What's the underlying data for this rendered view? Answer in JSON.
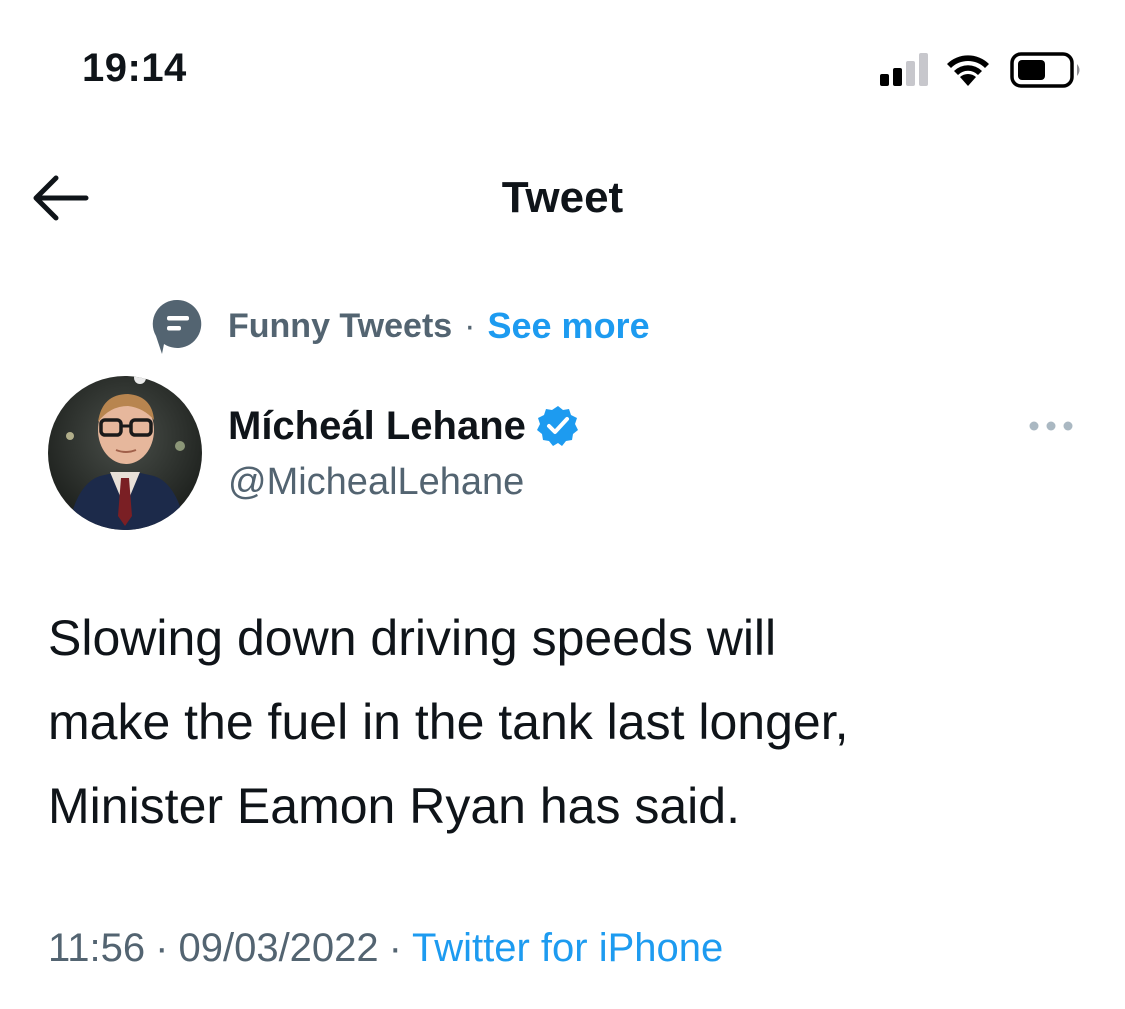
{
  "status_bar": {
    "time": "19:14"
  },
  "header": {
    "title": "Tweet"
  },
  "context": {
    "topic": "Funny Tweets",
    "separator": "·",
    "see_more": "See more"
  },
  "author": {
    "name": "Mícheál Lehane",
    "handle": "@MichealLehane",
    "verified": true
  },
  "tweet": {
    "text_lines": [
      "Slowing down driving speeds will",
      "make the fuel in the tank last longer,",
      "Minister Eamon Ryan has said."
    ]
  },
  "meta": {
    "time": "11:56",
    "date": "09/03/2022",
    "separator": "·",
    "source": "Twitter for iPhone"
  },
  "colors": {
    "accent": "#1d9bf0",
    "secondary_text": "#536471",
    "primary_text": "#0f1419"
  },
  "icons": [
    "signal-icon",
    "wifi-icon",
    "battery-icon",
    "back-arrow-icon",
    "topic-icon",
    "verified-badge-icon",
    "more-icon"
  ]
}
